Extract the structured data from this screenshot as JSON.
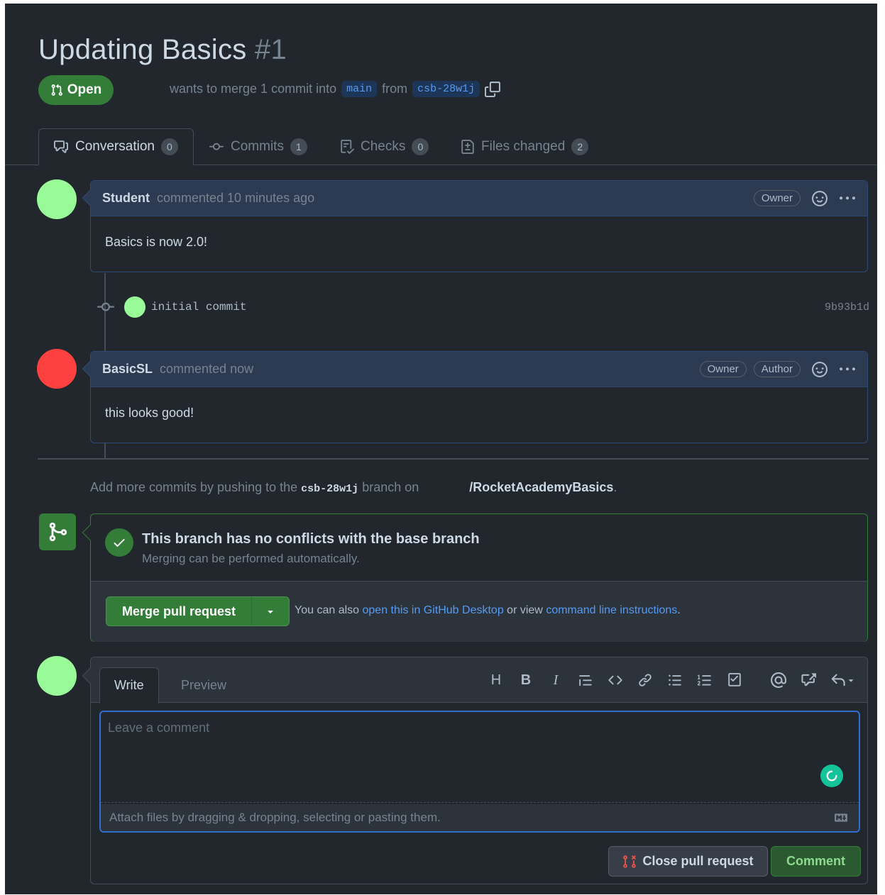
{
  "pr": {
    "title": "Updating Basics",
    "number": "#1",
    "state": "Open",
    "merge_text_pre": "wants to merge 1 commit into",
    "base_branch": "main",
    "merge_text_from": "from",
    "head_branch": "csb-28w1j"
  },
  "tabs": [
    {
      "label": "Conversation",
      "count": "0"
    },
    {
      "label": "Commits",
      "count": "1"
    },
    {
      "label": "Checks",
      "count": "0"
    },
    {
      "label": "Files changed",
      "count": "2"
    }
  ],
  "comments": [
    {
      "author": "Student",
      "meta": "commented 10 minutes ago",
      "labels": [
        "Owner"
      ],
      "body": "Basics is now 2.0!",
      "avatar_color": "#98fb98"
    },
    {
      "author": "BasicSL",
      "meta": "commented now",
      "labels": [
        "Owner",
        "Author"
      ],
      "body": "this looks good!",
      "avatar_color": "#ff4040"
    }
  ],
  "commit": {
    "message": "initial commit",
    "sha": "9b93b1d"
  },
  "hint": {
    "pre": "Add more commits by pushing to the",
    "branch": "csb-28w1j",
    "mid": "branch on",
    "repo": "/RocketAcademyBasics",
    "end": "."
  },
  "merge": {
    "title": "This branch has no conflicts with the base branch",
    "subtitle": "Merging can be performed automatically.",
    "button": "Merge pull request",
    "note_pre": "You can also",
    "link1": "open this in GitHub Desktop",
    "note_mid": "or view",
    "link2": "command line instructions",
    "note_end": "."
  },
  "editor": {
    "write_tab": "Write",
    "preview_tab": "Preview",
    "placeholder": "Leave a comment",
    "attach": "Attach files by dragging & dropping, selecting or pasting them.",
    "close_button": "Close pull request",
    "comment_button": "Comment"
  },
  "colors": {
    "background": "#22272e",
    "open_green": "#347d39",
    "link_blue": "#539bf5",
    "student_avatar": "#98fb98",
    "reviewer_avatar": "#ff4040"
  }
}
